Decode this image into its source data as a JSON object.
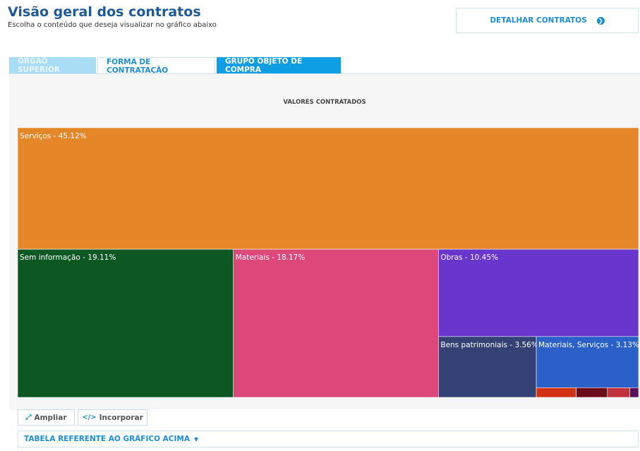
{
  "header": {
    "title": "Visão geral dos contratos",
    "subtitle": "Escolha o conteúdo que deseja visualizar no gráfico abaixo",
    "detail_button": "DETALHAR CONTRATOS",
    "detail_icon": "chevron-circle-right-icon"
  },
  "tabs": [
    {
      "label": "ÓRGÃO SUPERIOR",
      "state": "disabled"
    },
    {
      "label": "FORMA DE CONTRATAÇÃO",
      "state": "normal"
    },
    {
      "label": "GRUPO OBJETO DE COMPRA",
      "state": "selected"
    }
  ],
  "actions": {
    "ampliar": "Ampliar",
    "ampliar_icon": "expand-arrows-icon",
    "incorporar": "Incorporar",
    "incorporar_icon": "code-icon",
    "table_toggle": "TABELA REFERENTE AO GRÁFICO ACIMA",
    "table_toggle_icon": "caret-down-icon"
  },
  "chart_data": {
    "type": "treemap",
    "title": "VALORES CONTRATADOS",
    "unit": "%",
    "series": [
      {
        "name": "Serviços",
        "value": 45.12,
        "color": "#e58628",
        "label": "Serviços - 45.12%"
      },
      {
        "name": "Sem informação",
        "value": 19.11,
        "color": "#0d5723",
        "label": "Sem informação - 19.11%"
      },
      {
        "name": "Materiais",
        "value": 18.17,
        "color": "#dd477a",
        "label": "Materiais - 18.17%"
      },
      {
        "name": "Obras",
        "value": 10.45,
        "color": "#6836cc",
        "label": "Obras - 10.45%"
      },
      {
        "name": "Bens patrimoniais",
        "value": 3.56,
        "color": "#334174",
        "label": "Bens patrimoniais - 3.56%"
      },
      {
        "name": "Materiais, Serviços",
        "value": 3.13,
        "color": "#2a60c8",
        "label": "Materiais, Serviços - 3.13%"
      },
      {
        "value": 0.23,
        "color": "#d23214"
      },
      {
        "value": 0.18,
        "color": "#6c0b1b"
      },
      {
        "value": 0.13,
        "color": "#c0333d"
      },
      {
        "value": 0.05,
        "color": "#5b0f5b"
      }
    ]
  }
}
